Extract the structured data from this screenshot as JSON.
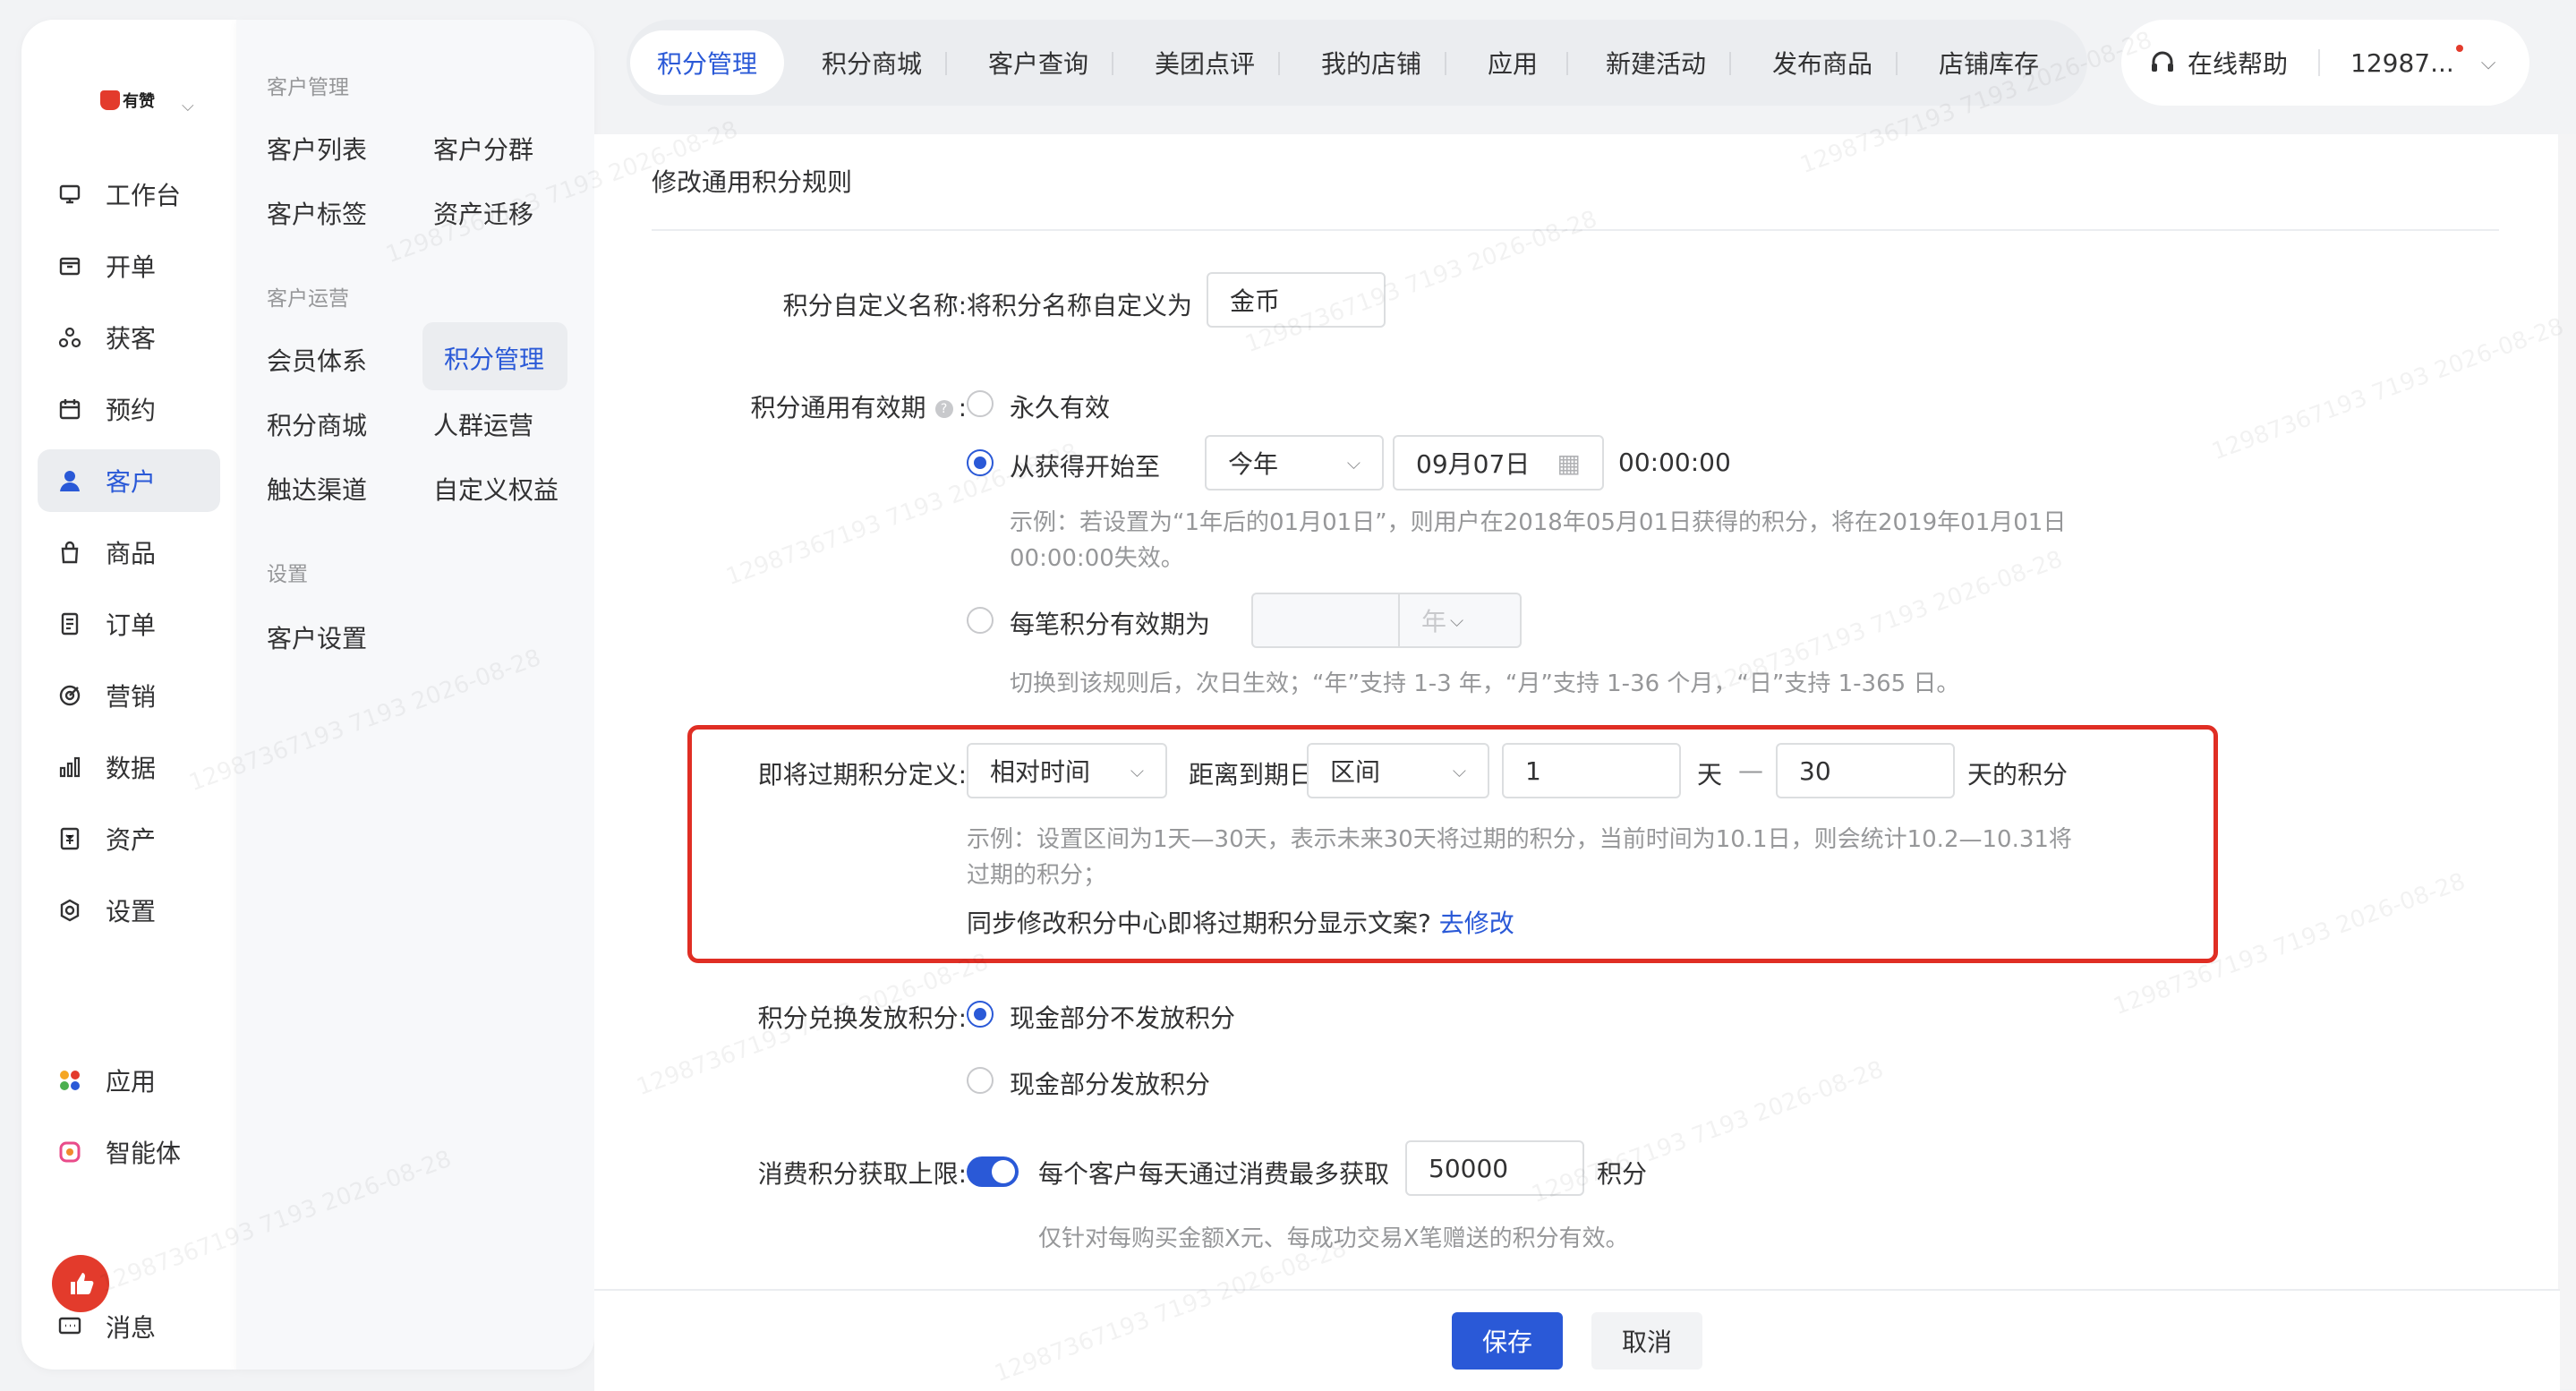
{
  "brand": {
    "logo_text": "有赞"
  },
  "sidebar": {
    "items": [
      {
        "label": "工作台",
        "icon": "workbench-icon"
      },
      {
        "label": "开单",
        "icon": "order-entry-icon"
      },
      {
        "label": "获客",
        "icon": "acquire-icon"
      },
      {
        "label": "预约",
        "icon": "calendar-icon"
      },
      {
        "label": "客户",
        "icon": "user-icon",
        "active": true
      },
      {
        "label": "商品",
        "icon": "bag-icon"
      },
      {
        "label": "订单",
        "icon": "order-icon"
      },
      {
        "label": "营销",
        "icon": "marketing-icon"
      },
      {
        "label": "数据",
        "icon": "chart-icon"
      },
      {
        "label": "资产",
        "icon": "asset-icon"
      },
      {
        "label": "设置",
        "icon": "gear-icon"
      }
    ],
    "extra_items": [
      {
        "label": "应用",
        "icon": "apps-icon"
      },
      {
        "label": "智能体",
        "icon": "agent-icon"
      }
    ],
    "message_label": "消息"
  },
  "subnav": {
    "groups": [
      {
        "title": "客户管理",
        "items": [
          "客户列表",
          "客户分群",
          "客户标签",
          "资产迁移"
        ]
      },
      {
        "title": "客户运营",
        "items": [
          "会员体系",
          "积分管理",
          "积分商城",
          "人群运营",
          "触达渠道",
          "自定义权益"
        ]
      },
      {
        "title": "设置",
        "items": [
          "客户设置"
        ]
      }
    ],
    "active_item": "积分管理"
  },
  "tabs": [
    "积分管理",
    "积分商城",
    "客户查询",
    "美团点评",
    "我的店铺",
    "应用",
    "新建活动",
    "发布商品",
    "店铺库存"
  ],
  "user": {
    "help_label": "在线帮助",
    "account": "12987..."
  },
  "form": {
    "title": "修改通用积分规则",
    "name": {
      "label": "积分自定义名称:",
      "prefix": "将积分名称自定义为",
      "value": "金币"
    },
    "validity": {
      "label": "积分通用有效期",
      "label_colon": ":",
      "option_forever": "永久有效",
      "option_from": "从获得开始至",
      "year_select": "今年",
      "date_value": "09月07日",
      "time_value": "00:00:00",
      "example_line1": "示例：若设置为“1年后的01月01日”，则用户在2018年05月01日获得的积分，将在2019年01月01日",
      "example_line2": "00:00:00失效。",
      "option_each": "每笔积分有效期为",
      "each_unit": "年",
      "each_hint": "切换到该规则后，次日生效；“年”支持 1-3 年，“月”支持 1-36 个月，“日”支持 1-365 日。"
    },
    "expiring": {
      "label": "即将过期积分定义:",
      "mode_select": "相对时间",
      "distance_label": "距离到期日",
      "range_select": "区间",
      "from_value": "1",
      "day_label": "天",
      "dash": "—",
      "to_value": "30",
      "suffix": "天的积分",
      "example_line1": "示例：设置区间为1天—30天，表示未来30天将过期的积分，当前时间为10.1日，则会统计10.2—10.31将",
      "example_line2": "过期的积分；",
      "sync_text": "同步修改积分中心即将过期积分显示文案?",
      "sync_link": "去修改"
    },
    "exchange": {
      "label": "积分兑换发放积分:",
      "option_no": "现金部分不发放积分",
      "option_yes": "现金部分发放积分"
    },
    "limit": {
      "label": "消费积分获取上限:",
      "text": "每个客户每天通过消费最多获取",
      "value": "50000",
      "unit": "积分",
      "hint": "仅针对每购买金额X元、每成功交易X笔赠送的积分有效。"
    }
  },
  "footer": {
    "save_label": "保存",
    "cancel_label": "取消"
  },
  "watermark": "12987367193 7193 2026-08-28",
  "colors": {
    "accent": "#2a59d7",
    "highlight_border": "#e02e24",
    "brand_red": "#e33b2c"
  }
}
